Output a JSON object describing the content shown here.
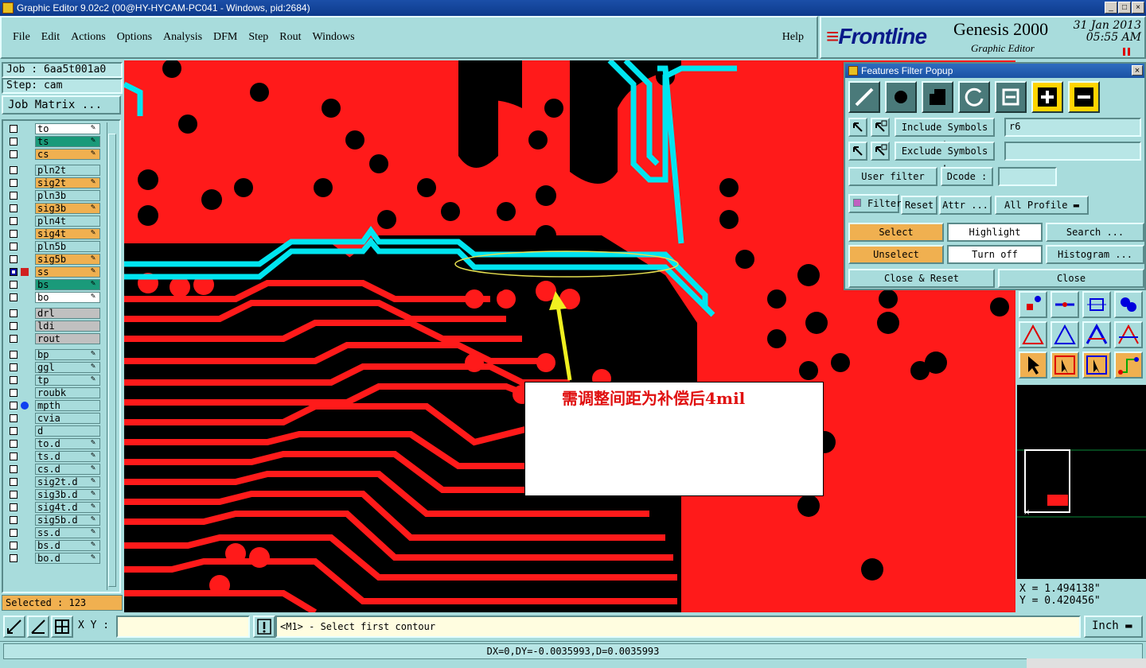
{
  "window": {
    "title": "Graphic Editor 9.02c2 (00@HY-HYCAM-PC041 - Windows, pid:2684)"
  },
  "menu": [
    "File",
    "Edit",
    "Actions",
    "Options",
    "Analysis",
    "DFM",
    "Step",
    "Rout",
    "Windows"
  ],
  "help_label": "Help",
  "brand": {
    "logo": "Frontline",
    "product": "Genesis 2000",
    "subtitle": "Graphic Editor",
    "date": "31 Jan 2013",
    "time": "05:55 AM"
  },
  "left": {
    "job": "Job : 6aa5t001a0",
    "step": "Step: cam",
    "job_matrix": "Job Matrix ...",
    "selected": "Selected : 123",
    "layers": [
      {
        "name": "to",
        "color": "#ffffff",
        "pen": true
      },
      {
        "name": "ts",
        "color": "#1a9a7a",
        "pen": true
      },
      {
        "name": "cs",
        "color": "#f0b050",
        "pen": true
      },
      {
        "name": "pln2t",
        "color": "#a8dcdc",
        "pen": false
      },
      {
        "name": "sig2t",
        "color": "#f0b050",
        "pen": true
      },
      {
        "name": "pln3b",
        "color": "#a8dcdc",
        "pen": false
      },
      {
        "name": "sig3b",
        "color": "#f0b050",
        "pen": true
      },
      {
        "name": "pln4t",
        "color": "#a8dcdc",
        "pen": false
      },
      {
        "name": "sig4t",
        "color": "#f0b050",
        "pen": true
      },
      {
        "name": "pln5b",
        "color": "#a8dcdc",
        "pen": false
      },
      {
        "name": "sig5b",
        "color": "#f0b050",
        "pen": true
      },
      {
        "name": "ss",
        "color": "#f0b050",
        "pen": true,
        "active": true
      },
      {
        "name": "bs",
        "color": "#1a9a7a",
        "pen": true
      },
      {
        "name": "bo",
        "color": "#ffffff",
        "pen": true
      },
      {
        "name": "drl",
        "color": "#c0c0c0",
        "pen": false
      },
      {
        "name": "ldi",
        "color": "#c0c0c0",
        "pen": false
      },
      {
        "name": "rout",
        "color": "#c0c0c0",
        "pen": false
      },
      {
        "name": "bp",
        "color": "#a8dcdc",
        "pen": true
      },
      {
        "name": "ggl",
        "color": "#a8dcdc",
        "pen": true
      },
      {
        "name": "tp",
        "color": "#a8dcdc",
        "pen": true
      },
      {
        "name": "roubk",
        "color": "#a8dcdc",
        "pen": false
      },
      {
        "name": "mpth",
        "color": "#a8dcdc",
        "pen": false,
        "dot": true
      },
      {
        "name": "cvia",
        "color": "#a8dcdc",
        "pen": false
      },
      {
        "name": "d",
        "color": "#a8dcdc",
        "pen": false
      },
      {
        "name": "to.d",
        "color": "#a8dcdc",
        "pen": true
      },
      {
        "name": "ts.d",
        "color": "#a8dcdc",
        "pen": true
      },
      {
        "name": "cs.d",
        "color": "#a8dcdc",
        "pen": true
      },
      {
        "name": "sig2t.d",
        "color": "#a8dcdc",
        "pen": true
      },
      {
        "name": "sig3b.d",
        "color": "#a8dcdc",
        "pen": true
      },
      {
        "name": "sig4t.d",
        "color": "#a8dcdc",
        "pen": true
      },
      {
        "name": "sig5b.d",
        "color": "#a8dcdc",
        "pen": true
      },
      {
        "name": "ss.d",
        "color": "#a8dcdc",
        "pen": true
      },
      {
        "name": "bs.d",
        "color": "#a8dcdc",
        "pen": true
      },
      {
        "name": "bo.d",
        "color": "#a8dcdc",
        "pen": true
      }
    ]
  },
  "annotation": {
    "text": "需调整间距为补偿后4mil"
  },
  "popup": {
    "title": "Features Filter Popup",
    "include_label": "Include Symbols :",
    "include_value": "r6",
    "exclude_label": "Exclude Symbols :",
    "exclude_value": "",
    "user_filter": "User filter ...",
    "dcode_label": "Dcode :",
    "dcode_value": "",
    "filter_label": "Filter",
    "reset": "Reset",
    "attr": "Attr ...",
    "profile": "All Profile",
    "select": "Select",
    "highlight": "Highlight",
    "search": "Search ...",
    "unselect": "Unselect",
    "turn_off": "Turn off",
    "histogram": "Histogram ...",
    "close_reset": "Close & Reset",
    "close": "Close"
  },
  "coords": {
    "x": "X = 1.494138\"",
    "y": "Y = 0.420456\""
  },
  "bottom": {
    "xy_label": "X Y :",
    "xy_value": "",
    "prompt": "<M1> - Select first contour",
    "units": "Inch"
  },
  "status": "DX=0,DY=-0.0035993,D=0.0035993",
  "colors": {
    "board": "#ff1a1a",
    "trace_highlight": "#00e5f0",
    "bg": "#a8dcdc",
    "accent": "#f0b050"
  }
}
